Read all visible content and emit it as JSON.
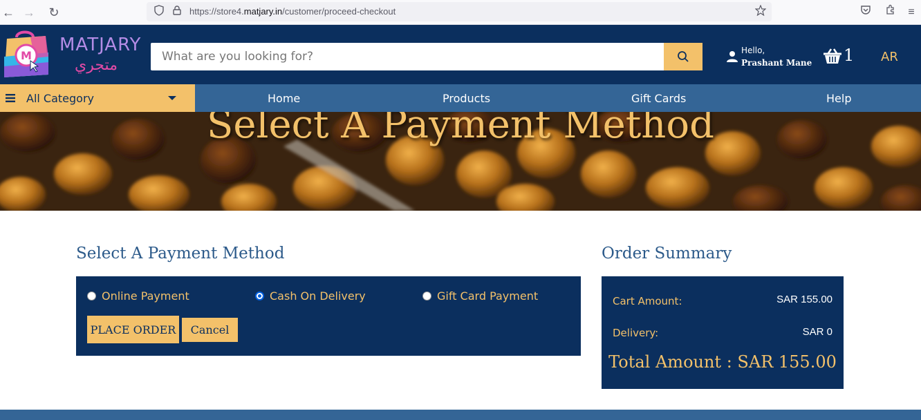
{
  "browser": {
    "url_prefix": "https://store4.",
    "url_domain": "matjary.in",
    "url_path": "/customer/proceed-checkout"
  },
  "header": {
    "logo_en": "MATJARY",
    "logo_ar": "متجري",
    "search_placeholder": "What are you looking for?",
    "greeting": "Hello,",
    "user_name": "Prashant Mane",
    "cart_count": "1",
    "language": "AR"
  },
  "nav": {
    "all_category": "All Category",
    "links": [
      "Home",
      "Products",
      "Gift Cards",
      "Help"
    ]
  },
  "banner": {
    "title": "Select A Payment Method"
  },
  "payment": {
    "title": "Select A Payment Method",
    "options": [
      {
        "label": "Online Payment",
        "selected": false
      },
      {
        "label": "Cash On Delivery",
        "selected": true
      },
      {
        "label": "Gift Card Payment",
        "selected": false
      }
    ],
    "place_order_label": "PLACE ORDER",
    "cancel_label": "Cancel"
  },
  "summary": {
    "title": "Order Summary",
    "cart_amount_label": "Cart Amount:",
    "cart_amount_value": "SAR 155.00",
    "delivery_label": "Delivery:",
    "delivery_value": "SAR 0",
    "total_text": "Total Amount : SAR 155.00"
  },
  "colors": {
    "navy": "#0b2f5e",
    "nav_blue": "#346596",
    "gold": "#f3c16a"
  }
}
